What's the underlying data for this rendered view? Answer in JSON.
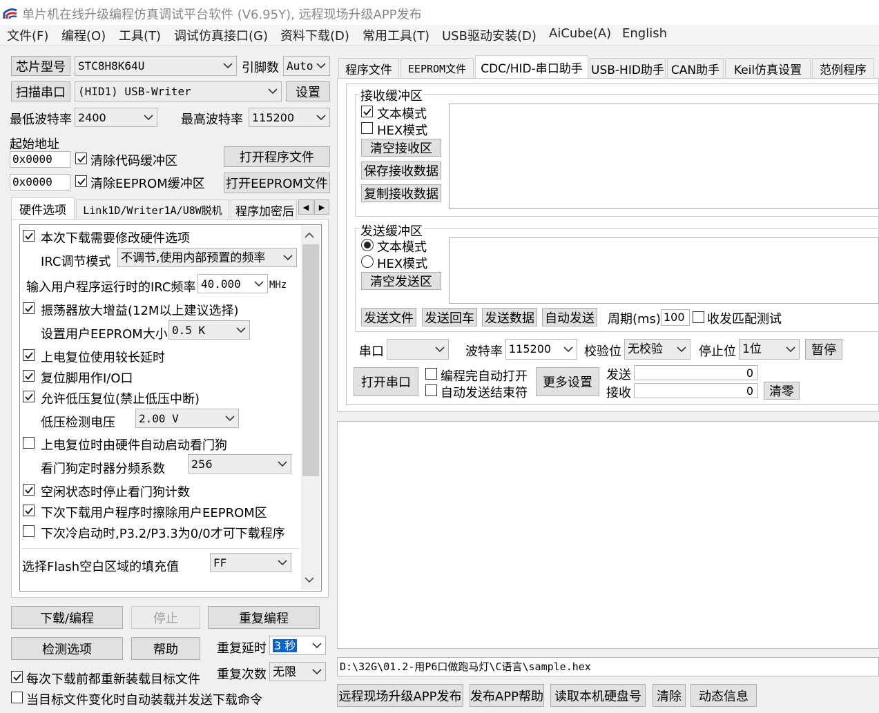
{
  "window": {
    "title": "单片机在线升级编程仿真调试平台软件 (V6.95Y), 远程现场升级APP发布"
  },
  "menu": [
    "文件(F)",
    "编程(O)",
    "工具(T)",
    "调试仿真接口(G)",
    "资料下载(D)",
    "常用工具(T)",
    "USB驱动安装(D)",
    "AiCube(A)",
    "English"
  ],
  "left": {
    "chip_label": "芯片型号",
    "chip_value": "STC8H8K64U",
    "pins_label": "引脚数",
    "pins_value": "Auto",
    "scan_button": "扫描串口",
    "port_value": "(HID1) USB-Writer",
    "settings_button": "设置",
    "min_baud_label": "最低波特率",
    "min_baud_value": "2400",
    "max_baud_label": "最高波特率",
    "max_baud_value": "115200",
    "start_addr_label": "起始地址",
    "addr1": "0x0000",
    "clear_code_label": "清除代码缓冲区",
    "open_program_button": "打开程序文件",
    "addr2": "0x0000",
    "clear_eeprom_label": "清除EEPROM缓冲区",
    "open_eeprom_button": "打开EEPROM文件",
    "tabs": [
      "硬件选项",
      "Link1D/Writer1A/U8W脱机",
      "程序加密后"
    ],
    "hw": {
      "modify_hw": "本次下载需要修改硬件选项",
      "irc_mode_label": "IRC调节模式",
      "irc_mode_value": "不调节,使用内部预置的频率",
      "irc_freq_label": "输入用户程序运行时的IRC频率",
      "irc_freq_value": "40.000",
      "irc_freq_unit": "MHz",
      "osc_gain": "振荡器放大增益(12M以上建议选择)",
      "eeprom_size_label": "设置用户EEPROM大小",
      "eeprom_size_value": "0.5 K",
      "long_delay": "上电复位使用较长延时",
      "reset_io": "复位脚用作I/O口",
      "low_volt_reset": "允许低压复位(禁止低压中断)",
      "low_volt_label": "低压检测电压",
      "low_volt_value": "2.00 V",
      "watchdog_auto": "上电复位时由硬件自动启动看门狗",
      "watchdog_div_label": "看门狗定时器分频系数",
      "watchdog_div_value": "256",
      "idle_stop_wdt": "空闲状态时停止看门狗计数",
      "erase_eeprom": "下次下载用户程序时擦除用户EEPROM区",
      "cold_boot": "下次冷启动时,P3.2/P3.3为0/0才可下载程序",
      "flash_fill_label": "选择Flash空白区域的填充值",
      "flash_fill_value": "FF"
    },
    "download_button": "下载/编程",
    "stop_button": "停止",
    "reprogram_button": "重复编程",
    "check_button": "检测选项",
    "help_button": "帮助",
    "repeat_delay_label": "重复延时",
    "repeat_delay_value": "3 秒",
    "repeat_count_label": "重复次数",
    "repeat_count_value": "无限",
    "reload_label": "每次下载前都重新装载目标文件",
    "auto_load_label": "当目标文件变化时自动装载并发送下载命令"
  },
  "right": {
    "tabs": [
      "程序文件",
      "EEPROM文件",
      "CDC/HID-串口助手",
      "USB-HID助手",
      "CAN助手",
      "Keil仿真设置",
      "范例程序"
    ],
    "receive": {
      "title": "接收缓冲区",
      "text_mode": "文本模式",
      "hex_mode": "HEX模式",
      "clear": "清空接收区",
      "save": "保存接收数据",
      "copy": "复制接收数据"
    },
    "send": {
      "title": "发送缓冲区",
      "text_mode": "文本模式",
      "hex_mode": "HEX模式",
      "clear": "清空发送区"
    },
    "send_file": "发送文件",
    "send_echo": "发送回车",
    "send_data": "发送数据",
    "auto_send": "自动发送",
    "period_label": "周期(ms)",
    "period_value": "100",
    "match_test": "收发匹配测试",
    "port_label": "串口",
    "baud_label": "波特率",
    "baud_value": "115200",
    "parity_label": "校验位",
    "parity_value": "无校验",
    "stop_label": "停止位",
    "stop_value": "1位",
    "pause_button": "暂停",
    "open_port_button": "打开串口",
    "auto_open_label": "编程完自动打开",
    "auto_send_end_label": "自动发送结束符",
    "more_settings_button": "更多设置",
    "tx_label": "发送",
    "tx_count": "0",
    "rx_label": "接收",
    "rx_count": "0",
    "clear_count_button": "清零",
    "path": "D:\\32G\\01.2-用P6口做跑马灯\\C语言\\sample.hex",
    "bottom_buttons": [
      "远程现场升级APP发布",
      "发布APP帮助",
      "读取本机硬盘号",
      "清除",
      "动态信息"
    ]
  }
}
